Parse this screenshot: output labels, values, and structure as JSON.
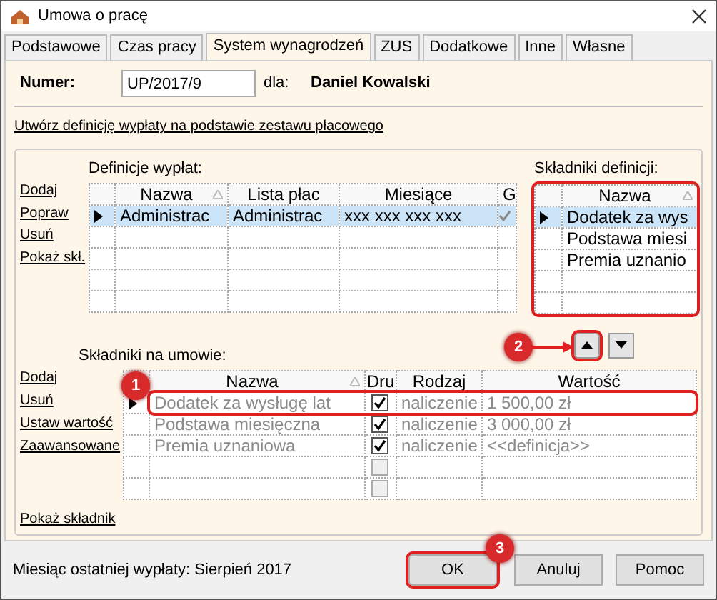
{
  "window": {
    "title": "Umowa o pracę"
  },
  "tabs": [
    {
      "label": "Podstawowe",
      "selected": false
    },
    {
      "label": "Czas pracy",
      "selected": false
    },
    {
      "label": "System wynagrodzeń",
      "selected": true
    },
    {
      "label": "ZUS",
      "selected": false
    },
    {
      "label": "Dodatkowe",
      "selected": false
    },
    {
      "label": "Inne",
      "selected": false
    },
    {
      "label": "Własne",
      "selected": false
    }
  ],
  "header": {
    "number_label": "Numer:",
    "number_value": "UP/2017/9",
    "for_label": "dla:",
    "employee": "Daniel Kowalski"
  },
  "create_link": "Utwórz definicję wypłaty na podstawie zestawu płacowego",
  "definitions": {
    "label": "Definicje wypłat:",
    "actions": [
      "Dodaj",
      "Popraw",
      "Usuń",
      "Pokaż skł."
    ],
    "columns": [
      "Nazwa",
      "Lista płac",
      "Miesiące",
      "G"
    ],
    "rows": [
      {
        "cells": [
          "Administrac",
          "Administrac",
          "xxx xxx xxx xxx"
        ],
        "checked": true,
        "selected": true
      }
    ]
  },
  "definition_items": {
    "label": "Składniki definicji:",
    "columns": [
      "Nazwa"
    ],
    "rows": [
      {
        "name": "Dodatek za wys",
        "selected": true
      },
      {
        "name": "Podstawa miesi",
        "selected": false
      },
      {
        "name": "Premia uznanio",
        "selected": false
      }
    ]
  },
  "contract_items": {
    "label": "Składniki na umowie:",
    "actions": [
      "Dodaj",
      "Usuń",
      "Ustaw wartość",
      "Zaawansowane"
    ],
    "columns": [
      "Nazwa",
      "Dru",
      "Rodzaj",
      "Wartość"
    ],
    "rows": [
      {
        "kind": "item",
        "name": "Dodatek za wysługę lat",
        "checked": true,
        "type": "naliczenie",
        "value": "1 500,00 zł",
        "current": true,
        "highlighted": true
      },
      {
        "kind": "item",
        "name": "Podstawa miesięczna",
        "checked": true,
        "type": "naliczenie",
        "value": "3 000,00 zł",
        "current": false,
        "highlighted": false
      },
      {
        "kind": "item",
        "name": "Premia uznaniowa",
        "checked": true,
        "type": "naliczenie",
        "value": "<<definicja>>",
        "current": false,
        "highlighted": false
      },
      {
        "kind": "empty",
        "checked": false
      },
      {
        "kind": "empty",
        "checked": false
      }
    ]
  },
  "show_item_link": "Pokaż składnik",
  "status": "Miesiąc ostatniej wypłaty: Sierpień 2017",
  "buttons": [
    {
      "label": "OK",
      "highlighted": true
    },
    {
      "label": "Anuluj",
      "highlighted": false
    },
    {
      "label": "Pomoc",
      "highlighted": false
    }
  ],
  "callouts": [
    {
      "label": "1"
    },
    {
      "label": "2"
    },
    {
      "label": "3"
    }
  ]
}
